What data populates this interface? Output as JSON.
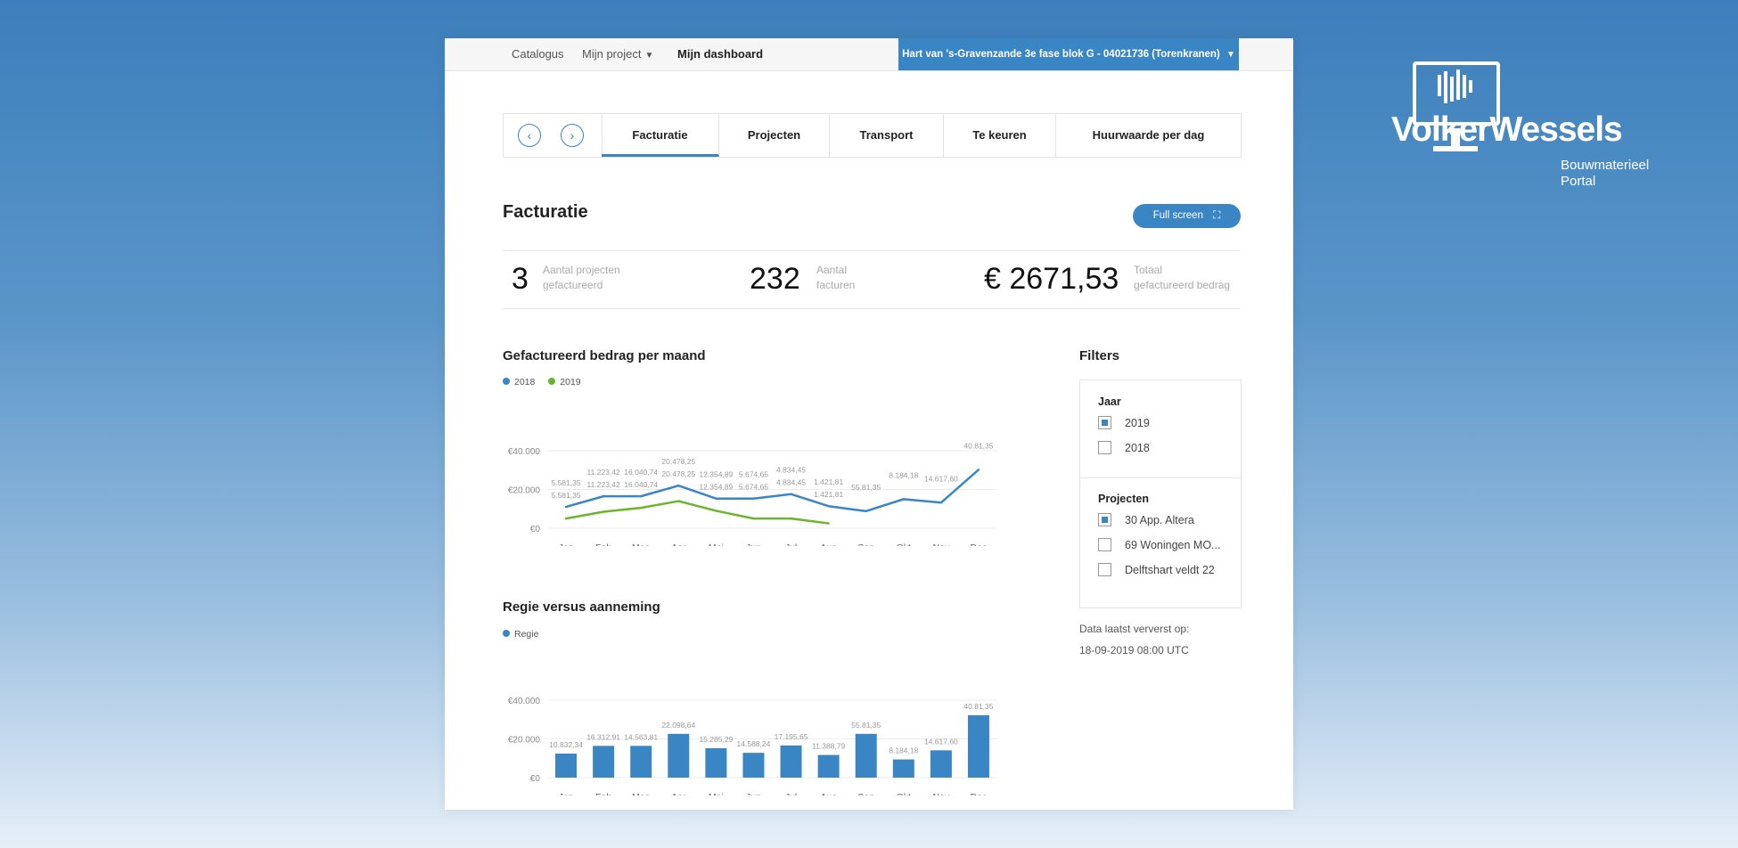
{
  "nav": {
    "catalogus": "Catalogus",
    "mijn_project": "Mijn project",
    "mijn_dashboard": "Mijn dashboard",
    "project_selector": "Hart van 's-Gravenzande 3e fase blok G - 04021736 (Torenkranen)"
  },
  "tabs": [
    "Facturatie",
    "Projecten",
    "Transport",
    "Te keuren",
    "Huurwaarde per dag"
  ],
  "page_title": "Facturatie",
  "fullscreen_label": "Full screen",
  "stats": [
    {
      "value": "3",
      "label1": "Aantal projecten",
      "label2": "gefactureerd"
    },
    {
      "value": "232",
      "label1": "Aantal",
      "label2": "facturen"
    },
    {
      "value": "€ 2671,53",
      "label1": "Totaal",
      "label2": "gefactureerd bedrag"
    }
  ],
  "chart1_title": "Gefactureerd bedrag per maand",
  "chart2_title": "Regie versus aanneming",
  "chart_data": [
    {
      "type": "line",
      "title": "Gefactureerd bedrag per maand",
      "categories": [
        "Jan",
        "Feb",
        "Maa",
        "Apr",
        "Mei",
        "Jun",
        "Jul",
        "Aug",
        "Sep",
        "Okt",
        "Nov",
        "Dec"
      ],
      "ylim": [
        0,
        40000
      ],
      "yticks": [
        "€0",
        "€20.000",
        "€40.000"
      ],
      "legend_position": "top-left",
      "series": [
        {
          "name": "2018",
          "color": "#3a86c4",
          "values": [
            11000,
            16500,
            16500,
            22000,
            15300,
            15300,
            17600,
            11400,
            8800,
            15000,
            13200,
            30200
          ],
          "labels": [
            "5.581,35",
            "11.223,42",
            "16.040,74",
            "20.478,25",
            "12.354,89",
            "5.674,65",
            "4.834,45",
            "1.421,81",
            "55.81,35",
            "8.184,18",
            "14.617,60",
            "40.81,35"
          ]
        },
        {
          "name": "2019",
          "color": "#6bb42b",
          "values": [
            5000,
            8500,
            10500,
            14000,
            9000,
            5000,
            5000,
            2500
          ],
          "labels": [
            "5.581,35",
            "11.223,42",
            "16.040,74",
            "20.478,25",
            "12.354,89",
            "5.674,65",
            "4.834,45",
            "1.421,81"
          ]
        }
      ]
    },
    {
      "type": "bar",
      "title": "Regie versus aanneming",
      "categories": [
        "Jan",
        "Feb",
        "Maa",
        "Apr",
        "Mei",
        "Jun",
        "Jul",
        "Aug",
        "Sep",
        "Okt",
        "Nov",
        "Dec"
      ],
      "ylim": [
        0,
        40000
      ],
      "yticks": [
        "€0",
        "€20.000",
        "€40.000"
      ],
      "legend_position": "top-left",
      "series": [
        {
          "name": "Regie",
          "color": "#3a86c4",
          "values": [
            12400,
            16400,
            16400,
            22600,
            15200,
            12800,
            16600,
            11700,
            22600,
            9400,
            14100,
            32200
          ],
          "labels": [
            "10.832,34",
            "16.312,91",
            "14.563,81",
            "22.098,64",
            "15.285,29",
            "14.588,24",
            "17.195,65",
            "11.388,79",
            "55.81,35",
            "8.184,18",
            "14.617,60",
            "40.81,35"
          ]
        }
      ]
    }
  ],
  "filters": {
    "title": "Filters",
    "jaar_title": "Jaar",
    "jaar_options": [
      {
        "label": "2019",
        "checked": true
      },
      {
        "label": "2018",
        "checked": false
      }
    ],
    "projecten_title": "Projecten",
    "projecten_options": [
      {
        "label": "30 App. Altera",
        "checked": true
      },
      {
        "label": "69 Woningen MO...",
        "checked": false
      },
      {
        "label": "Delftshart veldt 22",
        "checked": false
      }
    ],
    "refresh_label": "Data laatst ververst op:",
    "refresh_time": "18-09-2019 08:00 UTC"
  },
  "logo": {
    "word": "VolkerWessels",
    "sub1": "Bouwmaterieel",
    "sub2": "Portal"
  }
}
